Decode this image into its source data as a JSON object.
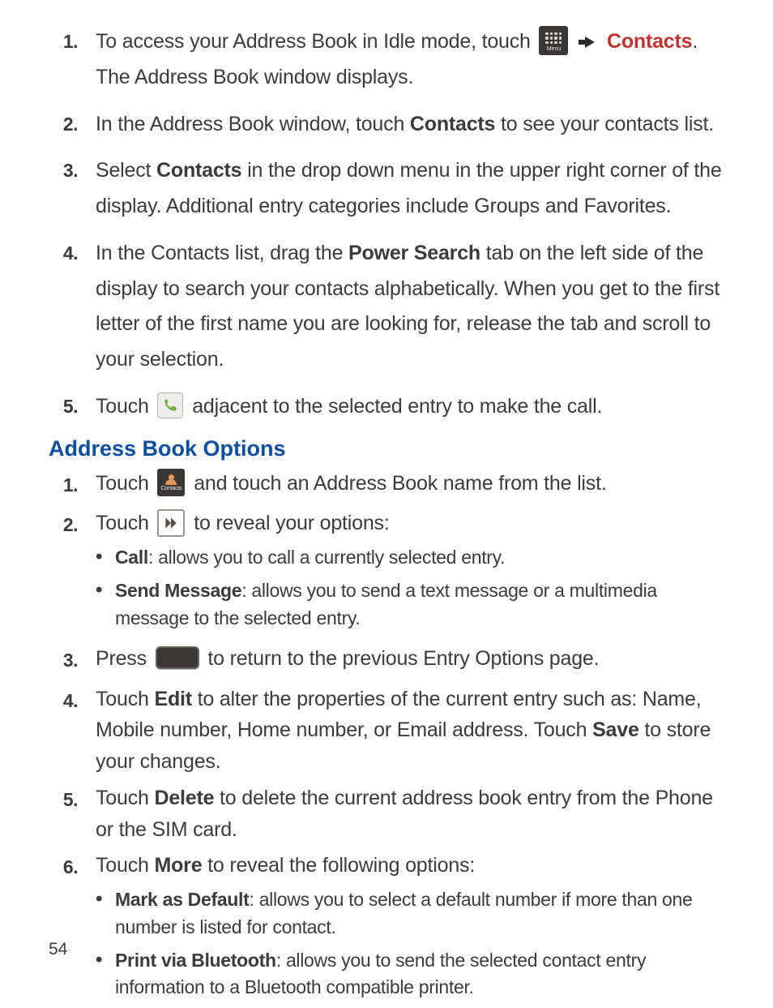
{
  "steps1": {
    "n1": "1.",
    "t1a": "To access your Address Book in Idle mode, touch ",
    "menu_label": "Menu",
    "t1_contacts": "Contacts",
    "t1b": ". The Address Book window displays.",
    "n2": "2.",
    "t2a": "In the Address Book window, touch ",
    "t2_contacts": "Contacts",
    "t2b": " to see your contacts list.",
    "n3": "3.",
    "t3a": "Select ",
    "t3_contacts": "Contacts",
    "t3b": " in the drop down menu in the upper right corner of the display. Additional entry categories include Groups and Favorites.",
    "n4": "4.",
    "t4a": "In the Contacts list, drag the ",
    "t4_power": "Power Search",
    "t4b": " tab on the left side of the display to search your contacts alphabetically. When you get to the first letter of the first name you are looking for, release the tab and scroll to your selection.",
    "n5": "5.",
    "t5a": "Touch ",
    "t5b": " adjacent to the selected entry to make the call."
  },
  "section": {
    "title": "Address Book Options"
  },
  "steps2": {
    "n1": "1.",
    "t1a": "Touch ",
    "contacts_label": "Contacts",
    "t1b": " and touch an Address Book name from the list.",
    "n2": "2.",
    "t2a": "Touch ",
    "t2b": " to reveal your options:",
    "sub_call_label": "Call",
    "sub_call_text": ": allows you to call a currently selected entry.",
    "sub_send_label": "Send Message",
    "sub_send_text": ": allows you to send a text message or a multimedia message to the selected entry.",
    "n3": "3.",
    "t3a": "Press ",
    "t3b": " to return to the previous Entry Options page.",
    "n4": "4.",
    "t4a": "Touch ",
    "t4_edit": "Edit",
    "t4b": " to alter the properties of the current entry such as: Name, Mobile number, Home number, or Email address. Touch ",
    "t4_save": "Save",
    "t4c": " to store your changes.",
    "n5": "5.",
    "t5a": "Touch ",
    "t5_delete": "Delete",
    "t5b": " to delete the current address book entry from the Phone or the SIM card.",
    "n6": "6.",
    "t6a": "Touch ",
    "t6_more": "More",
    "t6b": " to reveal the following options:",
    "sub_mark_label": "Mark as Default",
    "sub_mark_text": ": allows you to select a default number if more than one number is listed for contact.",
    "sub_print_label": "Print via Bluetooth",
    "sub_print_text": ": allows you to send the selected contact entry information to a Bluetooth compatible printer."
  },
  "page": "54"
}
